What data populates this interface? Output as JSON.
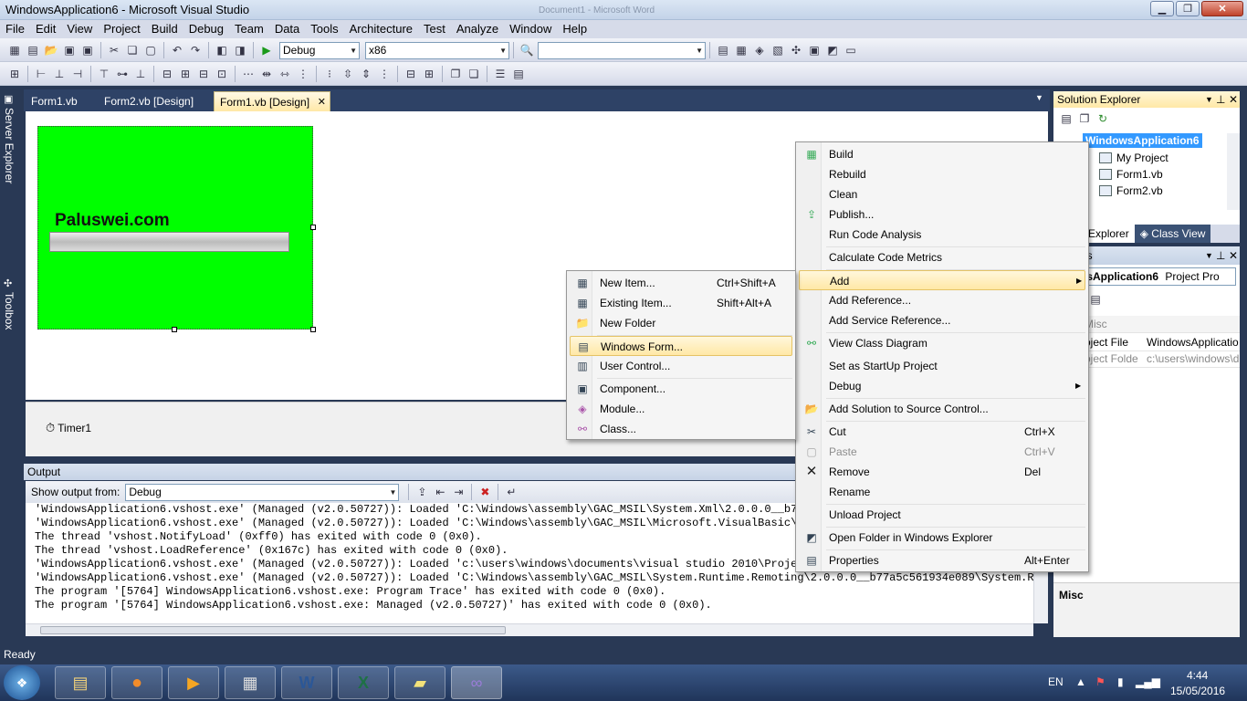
{
  "window": {
    "title": "WindowsApplication6 - Microsoft Visual Studio",
    "background_title": "Document1 - Microsoft Word"
  },
  "menubar": [
    "File",
    "Edit",
    "View",
    "Project",
    "Build",
    "Debug",
    "Team",
    "Data",
    "Tools",
    "Architecture",
    "Test",
    "Analyze",
    "Window",
    "Help"
  ],
  "toolbar": {
    "config": "Debug",
    "platform": "x86",
    "search": ""
  },
  "doc_tabs": [
    "Form1.vb",
    "Form2.vb [Design]",
    "Form1.vb [Design]"
  ],
  "side_tabs": [
    "Server Explorer",
    "Toolbox"
  ],
  "form": {
    "label": "Paluswei.com",
    "progress": 0
  },
  "tray": {
    "component": "Timer1"
  },
  "output": {
    "header": "Output",
    "show_from_label": "Show output from:",
    "show_from_value": "Debug",
    "lines": [
      "'WindowsApplication6.vshost.exe' (Managed (v2.0.50727)): Loaded 'C:\\Windows\\assembly\\GAC_MSIL\\System.Xml\\2.0.0.0__b77a5",
      "'WindowsApplication6.vshost.exe' (Managed (v2.0.50727)): Loaded 'C:\\Windows\\assembly\\GAC_MSIL\\Microsoft.VisualBasic\\8.0",
      "The thread 'vshost.NotifyLoad' (0xff0) has exited with code 0 (0x0).",
      "The thread 'vshost.LoadReference' (0x167c) has exited with code 0 (0x0).",
      "'WindowsApplication6.vshost.exe' (Managed (v2.0.50727)): Loaded 'c:\\users\\windows\\documents\\visual studio 2010\\Projects",
      "'WindowsApplication6.vshost.exe' (Managed (v2.0.50727)): Loaded 'C:\\Windows\\assembly\\GAC_MSIL\\System.Runtime.Remoting\\2.0.0.0__b77a5c561934e089\\System.Runti",
      "The program '[5764] WindowsApplication6.vshost.exe: Program Trace' has exited with code 0 (0x0).",
      "The program '[5764] WindowsApplication6.vshost.exe: Managed (v2.0.50727)' has exited with code 0 (0x0)."
    ]
  },
  "solution_explorer": {
    "title": "Solution Explorer",
    "items": [
      "WindowsApplication6",
      "My Project",
      "Form1.vb",
      "Form2.vb"
    ],
    "tabs": [
      "lution Explorer",
      "Class View"
    ]
  },
  "properties": {
    "title": "ties",
    "object": "wsApplication6",
    "object_type": "Project Pro",
    "category": "Misc",
    "rows": [
      {
        "name": "oject File",
        "value": "WindowsApplicatio"
      },
      {
        "name": "oject Folde",
        "value": "c:\\users\\windows\\d"
      }
    ],
    "desc_title": "Misc"
  },
  "context_menu": [
    {
      "label": "Build",
      "shortcut": "",
      "icon": "build-icon"
    },
    {
      "label": "Rebuild",
      "shortcut": ""
    },
    {
      "label": "Clean",
      "shortcut": ""
    },
    {
      "label": "Publish...",
      "shortcut": "",
      "icon": "publish-icon"
    },
    {
      "label": "Run Code Analysis",
      "shortcut": ""
    },
    {
      "label": "Calculate Code Metrics",
      "shortcut": ""
    },
    {
      "label": "Add",
      "shortcut": "",
      "submenu": true,
      "highlight": true
    },
    {
      "label": "Add Reference...",
      "shortcut": ""
    },
    {
      "label": "Add Service Reference...",
      "shortcut": ""
    },
    {
      "label": "View Class Diagram",
      "shortcut": "",
      "icon": "class-diagram-icon"
    },
    {
      "label": "Set as StartUp Project",
      "shortcut": ""
    },
    {
      "label": "Debug",
      "shortcut": "",
      "submenu": true
    },
    {
      "label": "Add Solution to Source Control...",
      "shortcut": "",
      "icon": "source-control-icon"
    },
    {
      "label": "Cut",
      "shortcut": "Ctrl+X",
      "icon": "scissors-icon"
    },
    {
      "label": "Paste",
      "shortcut": "Ctrl+V",
      "icon": "paste-icon",
      "disabled": true
    },
    {
      "label": "Remove",
      "shortcut": "Del",
      "icon": "remove-icon"
    },
    {
      "label": "Rename",
      "shortcut": ""
    },
    {
      "label": "Unload Project",
      "shortcut": ""
    },
    {
      "label": "Open Folder in Windows Explorer",
      "shortcut": "",
      "icon": "folder-icon"
    },
    {
      "label": "Properties",
      "shortcut": "Alt+Enter",
      "icon": "properties-icon"
    }
  ],
  "add_submenu": [
    {
      "label": "New Item...",
      "shortcut": "Ctrl+Shift+A"
    },
    {
      "label": "Existing Item...",
      "shortcut": "Shift+Alt+A"
    },
    {
      "label": "New Folder",
      "shortcut": ""
    },
    {
      "label": "Windows Form...",
      "shortcut": "",
      "highlight": true
    },
    {
      "label": "User Control...",
      "shortcut": ""
    },
    {
      "label": "Component...",
      "shortcut": ""
    },
    {
      "label": "Module...",
      "shortcut": ""
    },
    {
      "label": "Class...",
      "shortcut": ""
    }
  ],
  "status": "Ready",
  "taskbar": {
    "lang": "EN",
    "time": "4:44",
    "date": "15/05/2016"
  }
}
